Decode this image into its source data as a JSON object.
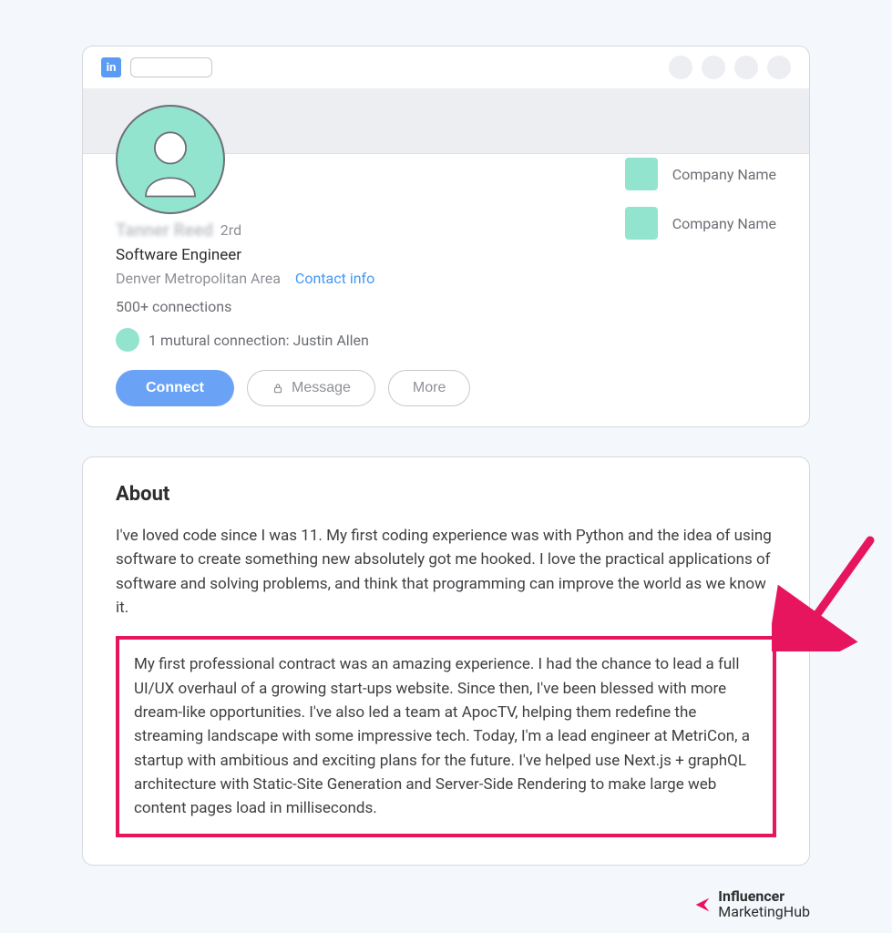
{
  "topbar": {
    "logo_glyph": "in"
  },
  "profile": {
    "blurred_name": "Tanner Reed",
    "degree": "2rd",
    "headline": "Software Engineer",
    "location": "Denver Metropolitan Area",
    "contact_label": "Contact info",
    "connections": "500+ connections",
    "mutual_text": "1 mutural connection: Justin Allen",
    "buttons": {
      "connect": "Connect",
      "message": "Message",
      "more": "More"
    },
    "companies": [
      {
        "name": "Company Name"
      },
      {
        "name": "Company Name"
      }
    ]
  },
  "about": {
    "title": "About",
    "p1": "I've loved code since I was 11. My first coding experience was with Python and the idea of using software to create something new absolutely got me hooked. I love the practical applications of software and solving problems, and think that programming can improve the world as we know it.",
    "p2": "My first professional contract was an amazing experience. I had the chance to lead a full UI/UX overhaul of a growing start-ups website. Since then, I've been blessed with more dream-like opportunities. I've also led a team at ApocTV, helping them redefine the streaming landscape with some impressive tech. Today, I'm a lead engineer at MetriCon, a startup with ambitious and exciting plans for the future. I've helped use Next.js + graphQL architecture with Static-Site Generation and Server-Side Rendering to make large web content pages load in milliseconds."
  },
  "footer": {
    "line1": "Influencer",
    "line2": "MarketingHub"
  }
}
